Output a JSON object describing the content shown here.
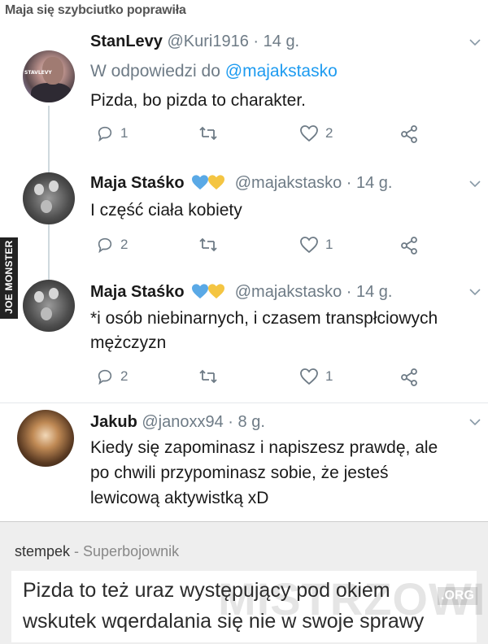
{
  "page_title": "Maja się szybciutko poprawiła",
  "watermark_side": "JOE MONSTER",
  "tweets": [
    {
      "avatar_logo": "STAVLEVY",
      "name": "StanLevy",
      "handle": "@Kuri1916 · 14 g.",
      "reply_prefix": "W odpowiedzi do ",
      "reply_mention": "@majakstasko",
      "lines": [
        "Pizda, bo pizda to charakter."
      ],
      "replies": "1",
      "likes": "2"
    },
    {
      "name": "Maja Staśko",
      "handle": "@majakstasko · 14 g.",
      "lines": [
        "I część ciała kobiety"
      ],
      "replies": "2",
      "likes": "1"
    },
    {
      "name": "Maja Staśko",
      "handle": "@majakstasko · 14 g.",
      "lines": [
        "*i osób niebinarnych, i czasem transpłciowych",
        "mężczyzn"
      ],
      "replies": "2",
      "likes": "1"
    },
    {
      "name": "Jakub",
      "handle": "@janoxx94 · 8 g.",
      "lines": [
        "Kiedy się zapominasz i napiszesz prawdę, ale",
        "po chwili przypominasz sobie, że jesteś",
        "lewicową aktywistką xD"
      ]
    }
  ],
  "colors": {
    "blue_heart": "#5aa9e6",
    "yellow_heart": "#f4c542",
    "mention": "#1d9bf0",
    "muted": "#6e7b86"
  },
  "comment": {
    "user": "stempek",
    "dash": " - ",
    "rank": "Superbojownik",
    "lines": [
      "Pizda to też uraz występujący pod okiem",
      "wskutek wqerdalania się nie w swoje sprawy"
    ],
    "watermark": "MISTRZOWIE",
    "watermark_suffix": ".ORG"
  }
}
